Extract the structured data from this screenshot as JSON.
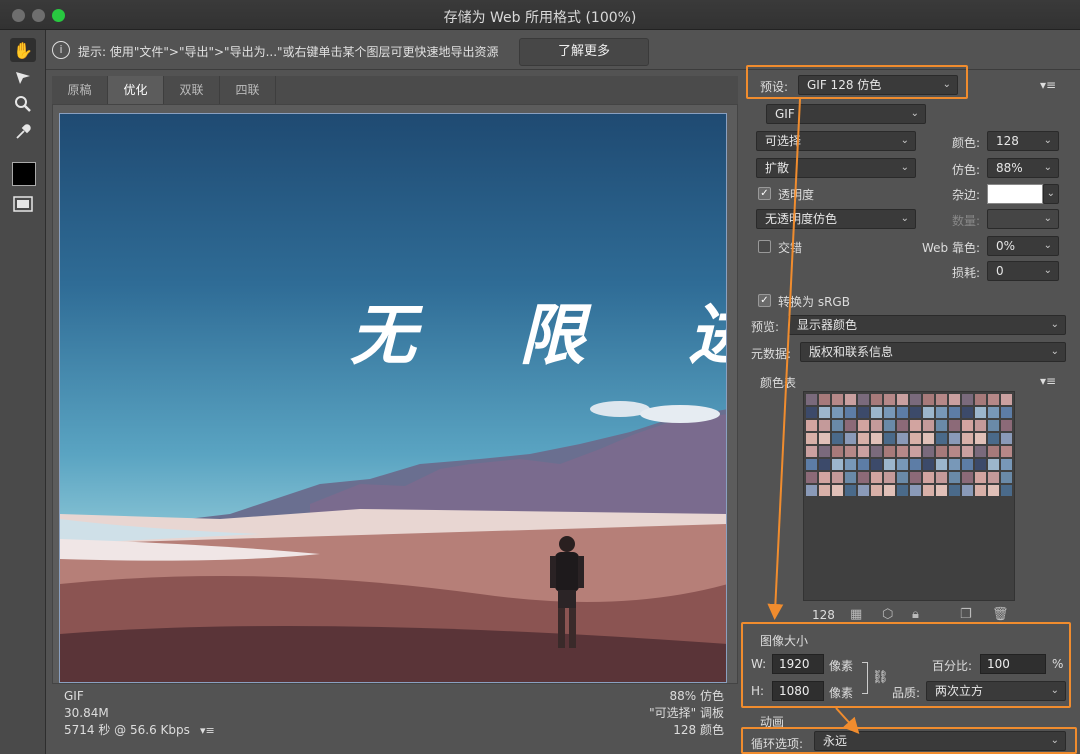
{
  "window": {
    "title": "存储为 Web 所用格式 (100%)"
  },
  "hint": {
    "icon": "info-icon",
    "text": "提示: 使用\"文件\">\"导出\">\"导出为...\"或右键单击某个图层可更快速地导出资源",
    "button": "了解更多"
  },
  "tabs": [
    {
      "label": "原稿"
    },
    {
      "label": "优化",
      "active": true
    },
    {
      "label": "双联"
    },
    {
      "label": "四联"
    }
  ],
  "image": {
    "overlay_text": "无 限 进"
  },
  "info_left": {
    "format": "GIF",
    "size": "30.84M",
    "time": "5714 秒 @ 56.6 Kbps"
  },
  "info_right": {
    "dither": "88% 仿色",
    "palette": "\"可选择\" 调板",
    "colors": "128 颜色"
  },
  "settings": {
    "preset_label": "预设:",
    "preset_value": "GIF 128 仿色",
    "format_value": "GIF",
    "reduction_value": "可选择",
    "colors_label": "颜色:",
    "colors_value": "128",
    "dither_algo": "扩散",
    "dither_label": "仿色:",
    "dither_value": "88%",
    "transparency_label": "透明度",
    "matte_label": "杂边:",
    "trans_dither_value": "无透明度仿色",
    "amount_label": "数量:",
    "interlaced_label": "交错",
    "web_snap_label": "Web 靠色:",
    "web_snap_value": "0%",
    "lossy_label": "损耗:",
    "lossy_value": "0",
    "convert_srgb_label": "转换为 sRGB",
    "preview_label": "预览:",
    "preview_value": "显示器颜色",
    "metadata_label": "元数据:",
    "metadata_value": "版权和联系信息",
    "color_table_label": "颜色表"
  },
  "color_table": {
    "count": "128"
  },
  "image_size": {
    "header": "图像大小",
    "w_label": "W:",
    "w_value": "1920",
    "h_label": "H:",
    "h_value": "1080",
    "unit": "像素",
    "percent_label": "百分比:",
    "percent_value": "100",
    "percent_unit": "%",
    "quality_label": "品质:",
    "quality_value": "两次立方"
  },
  "animation": {
    "header": "动画",
    "loop_label": "循环选项:",
    "loop_value": "永远"
  },
  "colors": {
    "highlight": "#f08c2e",
    "panel": "#535353"
  }
}
